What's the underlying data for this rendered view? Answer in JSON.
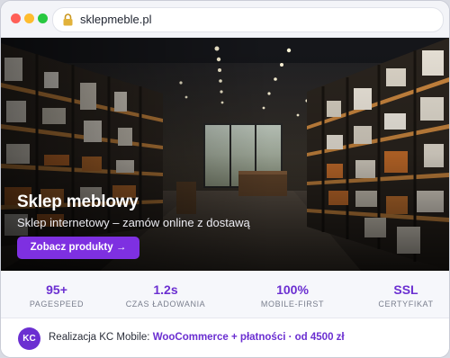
{
  "browser": {
    "url": "sklepmeble.pl"
  },
  "hero": {
    "title": "Sklep meblowy",
    "subtitle": "Sklep internetowy – zamów online z dostawą",
    "cta_label": "Zobacz produkty →"
  },
  "stats": [
    {
      "value": "95+",
      "label": "PAGESPEED"
    },
    {
      "value": "1.2s",
      "label": "CZAS ŁADOWANIA"
    },
    {
      "value": "100%",
      "label": "MOBILE-FIRST"
    },
    {
      "value": "SSL",
      "label": "CERTYFIKAT"
    }
  ],
  "footer": {
    "avatar_initials": "KC",
    "prefix": "Realizacja KC Mobile: ",
    "highlight": "WooCommerce + płatności · od 4500 zł"
  },
  "colors": {
    "accent": "#6b2fd1",
    "button": "#7e30e1"
  }
}
